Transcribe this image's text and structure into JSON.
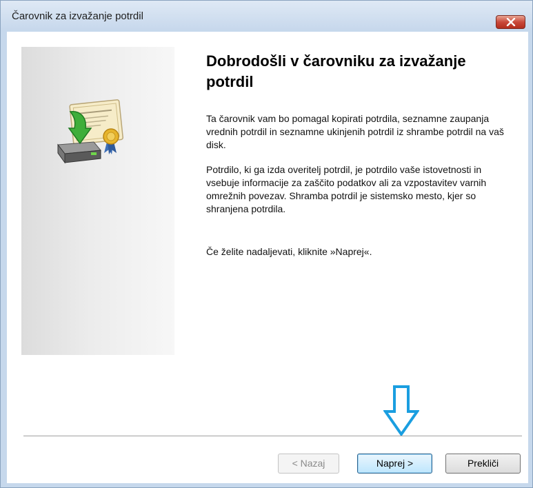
{
  "window": {
    "title": "Čarovnik za izvažanje potrdil"
  },
  "content": {
    "heading": "Dobrodošli v čarovniku za izvažanje potrdil",
    "paragraph1": "Ta čarovnik vam bo pomagal kopirati potrdila, seznamne zaupanja vrednih potrdil in seznamne ukinjenih potrdil iz shrambe potrdil na vaš disk.",
    "paragraph2": "Potrdilo, ki ga izda overitelj potrdil, je potrdilo vaše istovetnosti in vsebuje informacije za zaščito podatkov ali za vzpostavitev varnih omrežnih povezav. Shramba potrdil je sistemsko mesto, kjer so shranjena potrdila.",
    "paragraph3": "Če želite nadaljevati, kliknite »Naprej«."
  },
  "buttons": {
    "back": "< Nazaj",
    "next": "Naprej >",
    "cancel": "Prekliči"
  },
  "icons": {
    "close": "close-icon",
    "wizard": "certificate-export-icon",
    "hint_arrow": "down-arrow-icon"
  },
  "colors": {
    "close_button": "#c9493a",
    "hint_arrow": "#1a9ee0",
    "next_border": "#2c628b"
  }
}
